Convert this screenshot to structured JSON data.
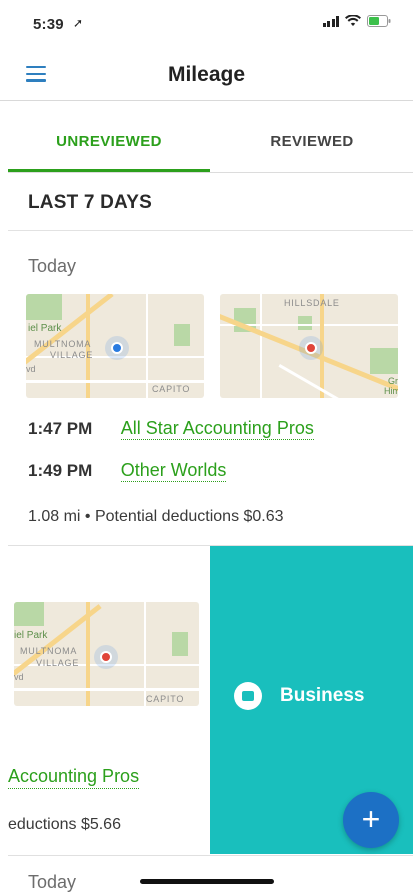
{
  "status_bar": {
    "time": "5:39"
  },
  "nav": {
    "title": "Mileage"
  },
  "tabs": [
    {
      "label": "UNREVIEWED",
      "active": true
    },
    {
      "label": "REVIEWED",
      "active": false
    }
  ],
  "section": {
    "header": "LAST 7 DAYS"
  },
  "group1": {
    "day": "Today",
    "map_left_labels": [
      "iel Park",
      "MULTNOMA",
      "VILLAGE",
      "vd",
      "CAPITO"
    ],
    "map_right_labels": [
      "HILLSDALE",
      "Gr",
      "Him"
    ],
    "trips": [
      {
        "time": "1:47 PM",
        "place": "All Star Accounting Pros"
      },
      {
        "time": "1:49 PM",
        "place": "Other Worlds"
      }
    ],
    "summary": "1.08 mi • Potential deductions $0.63"
  },
  "group2": {
    "map_labels": [
      "iel Park",
      "MULTNOMA",
      "VILLAGE",
      "vd",
      "CAPITO"
    ],
    "place_fragment": "Accounting Pros",
    "summary_fragment": "eductions $5.66",
    "action_label": "Business"
  },
  "group3": {
    "day": "Today"
  },
  "colors": {
    "accent_green": "#2ca01c",
    "business_teal": "#19bfbd",
    "fab_blue": "#1c70c5"
  },
  "icons": [
    "hamburger-menu-icon",
    "signal-icon",
    "wifi-icon",
    "battery-icon",
    "briefcase-icon",
    "plus-icon"
  ]
}
